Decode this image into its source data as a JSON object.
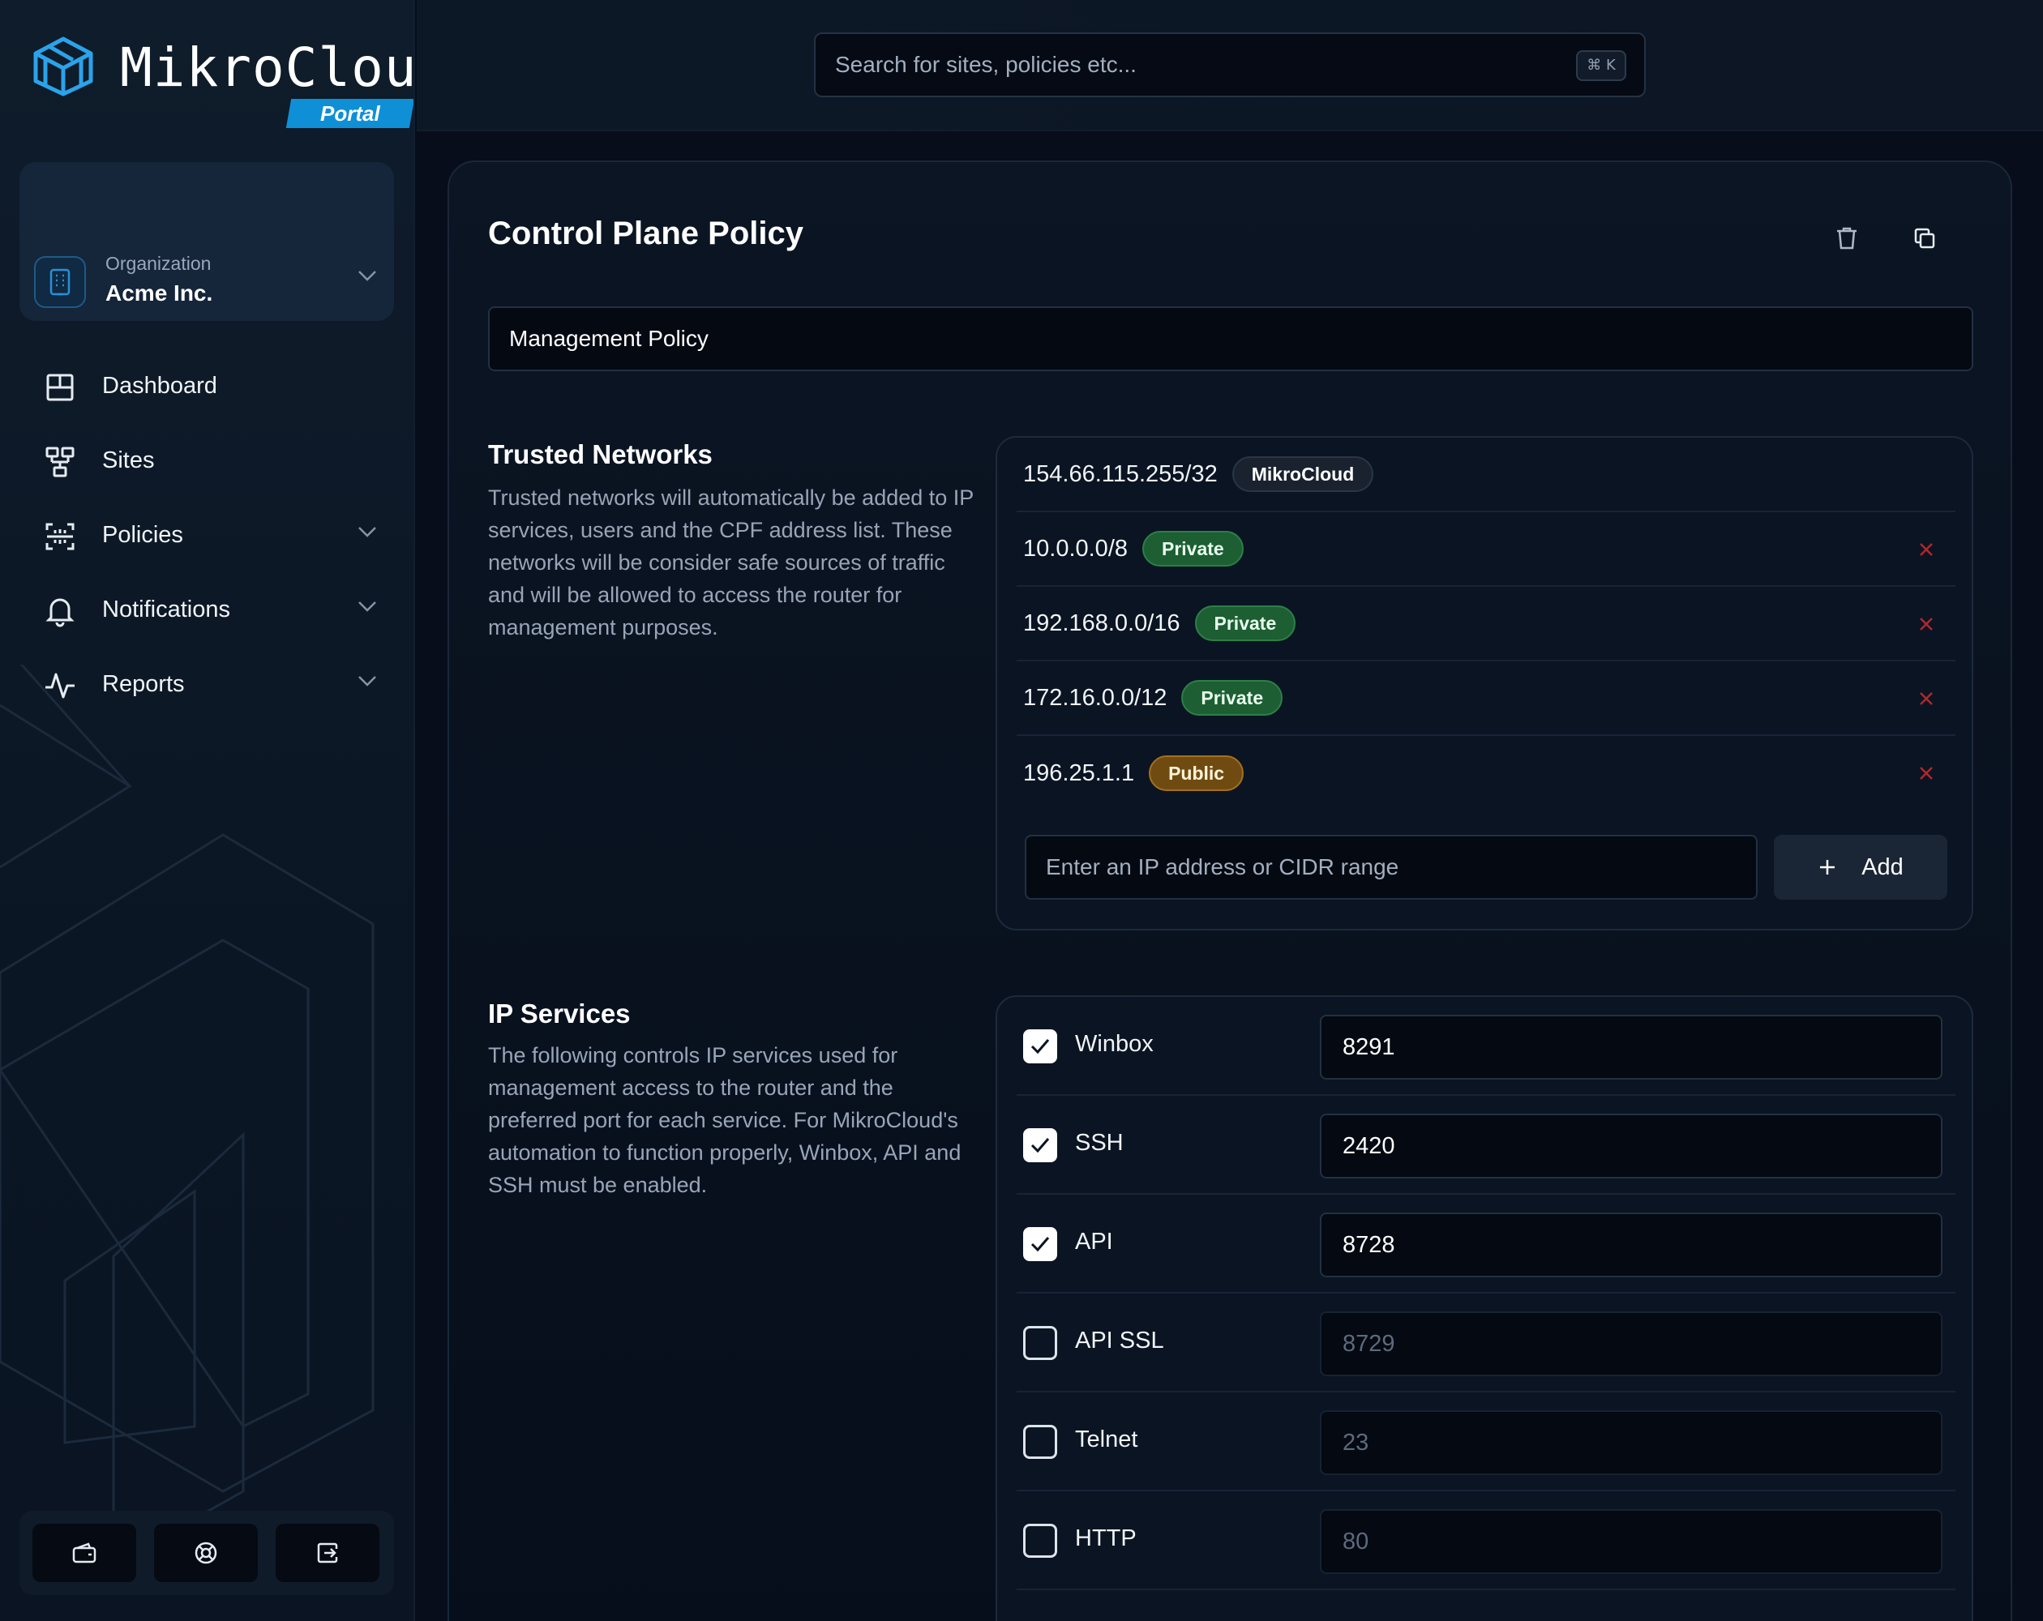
{
  "brand": {
    "name": "MikroCloud",
    "tag": "Portal",
    "accent": "#0f8fd6"
  },
  "organization": {
    "label": "Organization",
    "name": "Acme Inc."
  },
  "nav": [
    {
      "label": "Dashboard",
      "icon": "dashboard-icon",
      "expandable": false
    },
    {
      "label": "Sites",
      "icon": "sites-icon",
      "expandable": false
    },
    {
      "label": "Policies",
      "icon": "policies-icon",
      "expandable": true
    },
    {
      "label": "Notifications",
      "icon": "bell-icon",
      "expandable": true
    },
    {
      "label": "Reports",
      "icon": "activity-icon",
      "expandable": true
    }
  ],
  "bottom_actions": [
    "wallet-icon",
    "support-icon",
    "logout-icon"
  ],
  "search": {
    "placeholder": "Search for sites, policies etc...",
    "shortcut": "⌘ K"
  },
  "policy": {
    "title": "Control Plane Policy",
    "name_value": "Management Policy"
  },
  "trusted_networks": {
    "title": "Trusted Networks",
    "description": "Trusted networks will automatically be added to IP services, users and the CPF address list. These networks will be consider safe sources of traffic and will be allowed to access the router for management purposes.",
    "rows": [
      {
        "ip": "154.66.115.255/32",
        "tag": "MikroCloud",
        "kind": "mikrocloud",
        "removable": false
      },
      {
        "ip": "10.0.0.0/8",
        "tag": "Private",
        "kind": "private",
        "removable": true
      },
      {
        "ip": "192.168.0.0/16",
        "tag": "Private",
        "kind": "private",
        "removable": true
      },
      {
        "ip": "172.16.0.0/12",
        "tag": "Private",
        "kind": "private",
        "removable": true
      },
      {
        "ip": "196.25.1.1",
        "tag": "Public",
        "kind": "public",
        "removable": true
      }
    ],
    "input_placeholder": "Enter an IP address or CIDR range",
    "add_label": "Add"
  },
  "ip_services": {
    "title": "IP Services",
    "description": "The following controls IP services used for management access to the router and the preferred port for each service. For MikroCloud's automation to function properly, Winbox, API and SSH must be enabled.",
    "services": [
      {
        "name": "Winbox",
        "enabled": true,
        "port": "8291"
      },
      {
        "name": "SSH",
        "enabled": true,
        "port": "2420"
      },
      {
        "name": "API",
        "enabled": true,
        "port": "8728"
      },
      {
        "name": "API SSL",
        "enabled": false,
        "port": "8729"
      },
      {
        "name": "Telnet",
        "enabled": false,
        "port": "23"
      },
      {
        "name": "HTTP",
        "enabled": false,
        "port": "80"
      }
    ]
  }
}
